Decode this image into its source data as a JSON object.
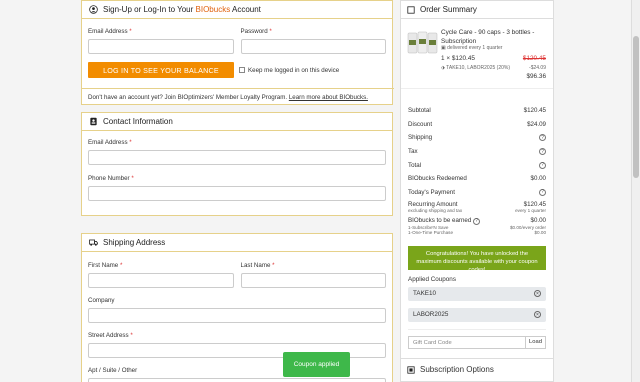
{
  "signup": {
    "title_prefix": "Sign-Up or Log-In to Your ",
    "title_brand": "BIObucks",
    "title_suffix": " Account",
    "email_label": "Email Address",
    "password_label": "Password",
    "required_mark": "*",
    "login_button": "LOG IN TO SEE YOUR BALANCE",
    "remember_label": "Keep me logged in on this device",
    "loyalty_text": "Don't have an account yet? Join BIOptimizers' Member Loyalty Program.",
    "loyalty_link": "Learn more about BIObucks."
  },
  "contact": {
    "title": "Contact Information",
    "email_label": "Email Address",
    "phone_label": "Phone Number"
  },
  "shipping": {
    "title": "Shipping Address",
    "first_name_label": "First Name",
    "last_name_label": "Last Name",
    "company_label": "Company",
    "street_label": "Street Address",
    "apt_label": "Apt / Suite / Other"
  },
  "order": {
    "title": "Order Summary",
    "product_name": "Cycle Care - 90 caps - 3 bottles - Subscription",
    "delivery_note": "delivered every 1 quarter",
    "qty_price": "1 × $120.45",
    "old_price": "$120.45",
    "discount_codes": "TAKE10, LABOR2025 (20%)",
    "discount_amount": "-$24.09",
    "line_total": "$96.36",
    "summary": [
      {
        "label": "Subtotal",
        "value": "$120.45"
      },
      {
        "label": "Discount",
        "value": "$24.09"
      },
      {
        "label": "Shipping",
        "value": "?"
      },
      {
        "label": "Tax",
        "value": "?"
      },
      {
        "label": "Total",
        "value": "?"
      },
      {
        "label": "BIObucks Redeemed",
        "value": "$0.00"
      },
      {
        "label": "Today's Payment",
        "value": "?"
      }
    ],
    "recurring_label": "Recurring Amount",
    "recurring_sub": "excluding shipping and tax",
    "recurring_value": "$120.45",
    "recurring_period": "every 1 quarter",
    "earned_label": "BIObucks to be earned",
    "earned_value": "$0.00",
    "earned_sub1_label": "1-Subscribe'N Save",
    "earned_sub1_value": "$0.00/every order",
    "earned_sub2_label": "1-One-Time Purchase",
    "earned_sub2_value": "$0.00",
    "congrats": "Congratulations! You have unlocked the maximum discounts available with your coupon codes!",
    "applied_label": "Applied Coupons",
    "coupons": [
      "TAKE10",
      "LABOR2025"
    ],
    "gift_placeholder": "Gift Card Code",
    "load_button": "Load",
    "subscription_title": "Subscription Options"
  },
  "toast": "Coupon applied",
  "colors": {
    "accent": "#f28c00",
    "border": "#e6d18a",
    "success": "#3eb84a",
    "congrats": "#7aa51a"
  }
}
